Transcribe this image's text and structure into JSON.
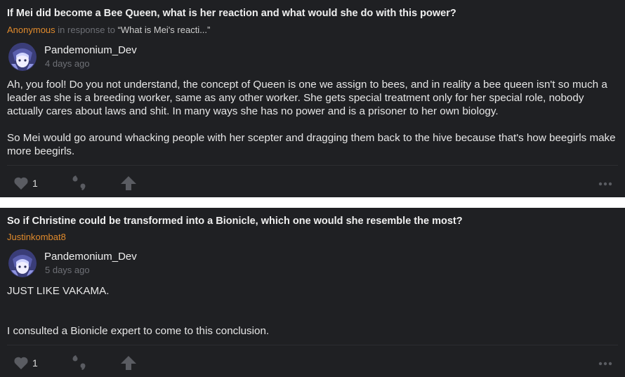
{
  "posts": [
    {
      "question": "If Mei did become a Bee Queen, what is her reaction and what would she do with this power?",
      "asker": "Anonymous",
      "in_response_label": "in response to",
      "quote_ref": "“What is Mei's reacti...”",
      "author": "Pandemonium_Dev",
      "time": "4 days ago",
      "paragraphs": [
        "Ah, you fool! Do you not understand, the concept of Queen is one we assign to bees, and in reality a bee queen isn't so much a leader as she is a breeding worker, same as any other worker. She gets special treatment only for her special role, nobody actually cares about laws and shit. In many ways she has no power and is a prisoner to her own biology.",
        "So Mei would go around whacking people with her scepter and dragging them back to the hive because that's how beegirls make more beegirls."
      ],
      "likes": "1"
    },
    {
      "question": "So if Christine could be transformed into a Bionicle, which one would she resemble the most?",
      "asker": "Justinkombat8",
      "author": "Pandemonium_Dev",
      "time": "5 days ago",
      "paragraphs": [
        "JUST LIKE VAKAMA.",
        "I consulted a Bionicle expert to come to this conclusion."
      ],
      "likes": "1"
    }
  ],
  "colors": {
    "card_bg": "#1f2023",
    "accent_orange": "#e08a2c",
    "muted": "#6d6f75",
    "icon": "#5a5c62"
  },
  "icons": [
    "heart-icon",
    "quote-icon",
    "boost-arrow-icon",
    "more-dots-icon"
  ]
}
